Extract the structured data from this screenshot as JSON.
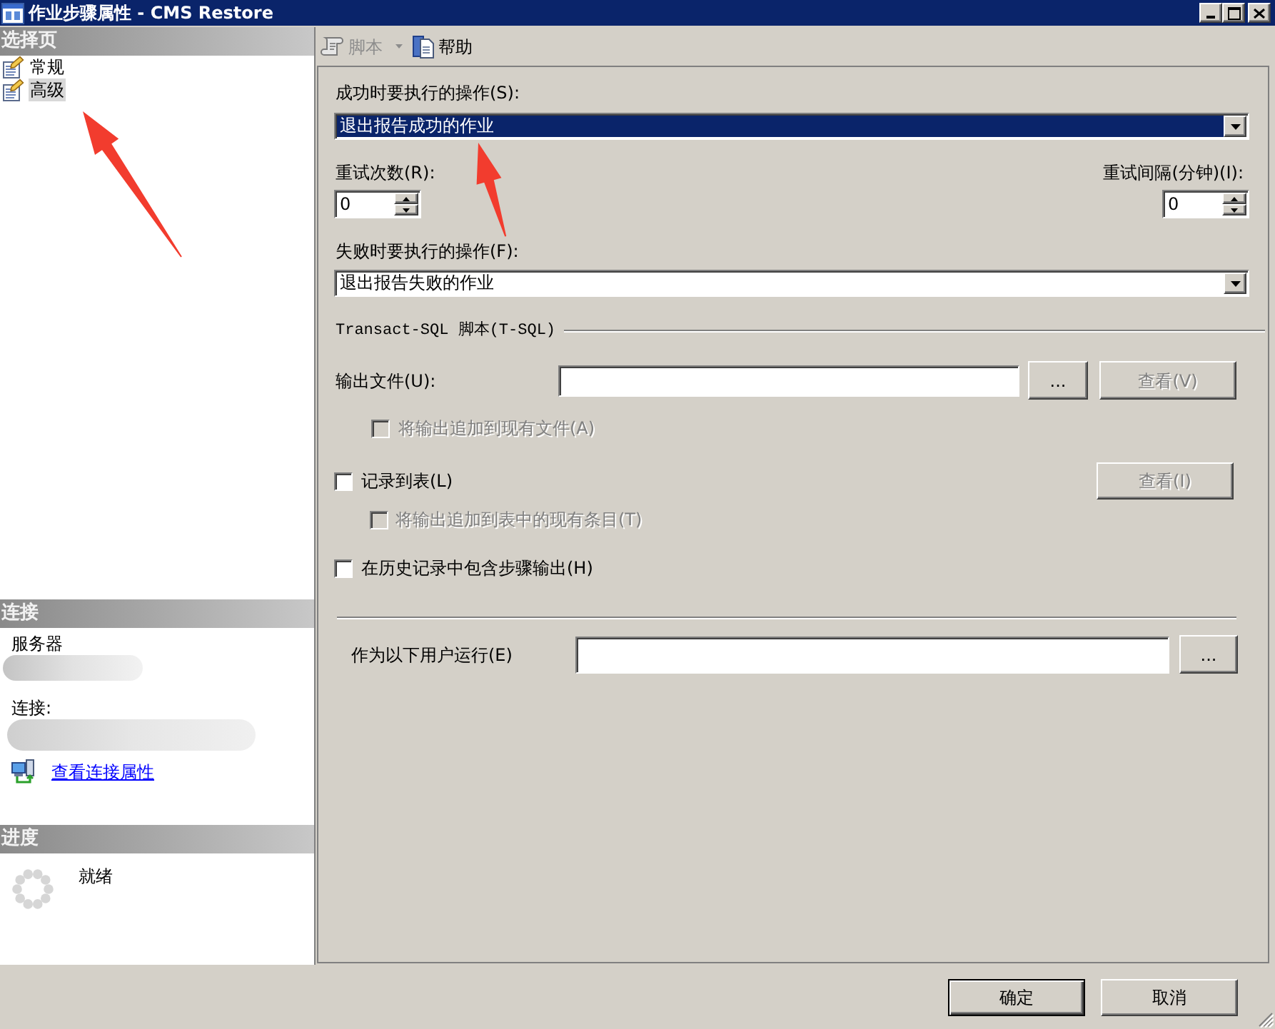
{
  "window": {
    "title": "作业步骤属性 - CMS Restore"
  },
  "sidebar": {
    "pages_header": "选择页",
    "pages": [
      {
        "label": "常规",
        "selected": false
      },
      {
        "label": "高级",
        "selected": true
      }
    ],
    "connection": {
      "header": "连接",
      "server_label": "服务器",
      "connection_label": "连接:",
      "properties_link": "查看连接属性"
    },
    "progress": {
      "header": "进度",
      "status": "就绪"
    }
  },
  "toolbar": [
    {
      "kind": "dropdown",
      "label": "脚本",
      "disabled": true
    },
    {
      "kind": "button",
      "label": "帮助",
      "disabled": false
    }
  ],
  "form": {
    "on_success": {
      "label": "成功时要执行的操作(S):",
      "value": "退出报告成功的作业",
      "focused": true
    },
    "retry_attempts": {
      "label": "重试次数(R):",
      "value": "0"
    },
    "retry_interval": {
      "label": "重试间隔(分钟)(I):",
      "value": "0"
    },
    "on_failure": {
      "label": "失败时要执行的操作(F):",
      "value": "退出报告失败的作业",
      "focused": false
    },
    "tsql": {
      "title": "Transact-SQL 脚本(T-SQL)",
      "output_file": {
        "label": "输出文件(U):",
        "browse_button": "...",
        "view_button": {
          "label": "查看(V)",
          "disabled": true
        },
        "append": {
          "label": "将输出追加到现有文件(A)",
          "checked": false,
          "disabled": true
        }
      },
      "log_to_table": {
        "label": "记录到表(L)",
        "checked": false,
        "disabled": false,
        "view_button": {
          "label": "查看(I)",
          "disabled": true
        },
        "append": {
          "label": "将输出追加到表中的现有条目(T)",
          "checked": false,
          "disabled": true
        }
      },
      "include_history": {
        "label": "在历史记录中包含步骤输出(H)",
        "checked": false,
        "disabled": false
      }
    },
    "run_as": {
      "label": "作为以下用户运行(E)",
      "browse_button": "..."
    }
  },
  "buttons": [
    {
      "label": "确定",
      "default": true
    },
    {
      "label": "取消",
      "default": false
    }
  ]
}
